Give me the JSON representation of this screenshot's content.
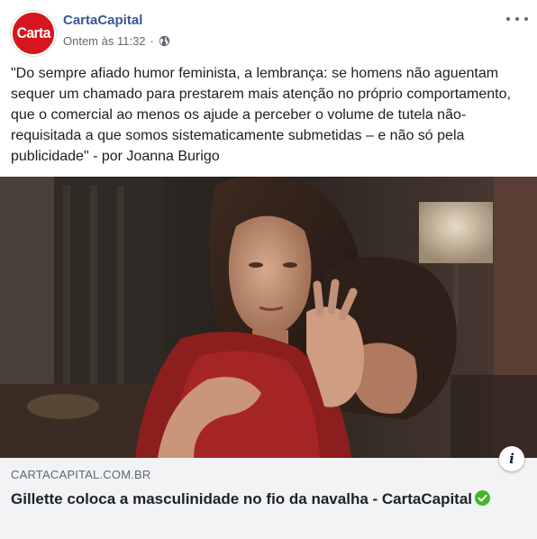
{
  "post": {
    "page_name": "CartaCapital",
    "avatar_text": "Carta",
    "timestamp": "Ontem às 11:32",
    "separator": "·",
    "privacy_icon": "globe-icon",
    "menu_icon": "more-horizontal-icon",
    "text": "\"Do sempre afiado humor feminista, a lembrança: se homens não aguentam sequer um chamado para prestarem mais atenção no próprio comportamento, que o comercial ao menos os ajude a perceber o volume de tutela não-requisitada a que somos sistematicamente submetidas – e não só pela publicidade\" - por Joanna Burigo"
  },
  "link_preview": {
    "domain": "CARTACAPITAL.COM.BR",
    "title": "Gillette coloca a masculinidade no fio da navalha - CartaCapital",
    "verified_icon": "verified-check-icon",
    "info_icon": "info-icon",
    "info_label": "i"
  },
  "colors": {
    "brand_red": "#d6161c",
    "link_blue": "#385898",
    "verified_green": "#42b72a",
    "preview_bg": "#f2f3f5"
  }
}
